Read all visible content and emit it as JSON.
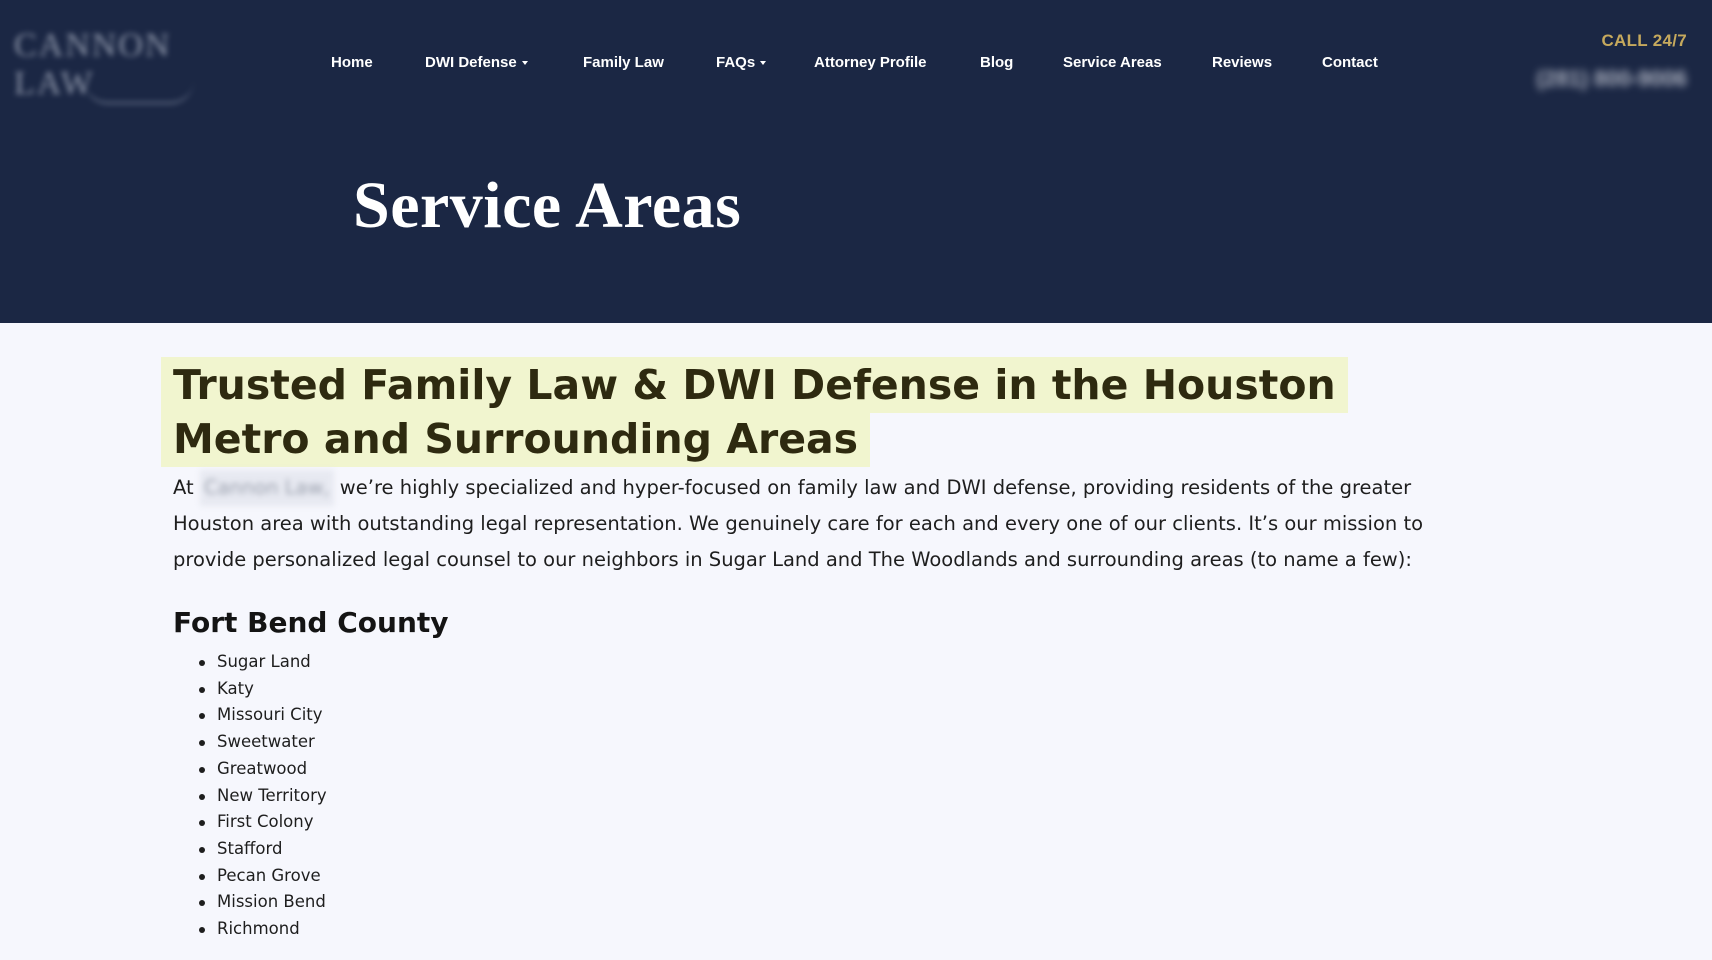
{
  "header": {
    "logo_text": "CANNON LAW",
    "nav": [
      {
        "label": "Home",
        "dropdown": false
      },
      {
        "label": "DWI Defense",
        "dropdown": true
      },
      {
        "label": "Family Law",
        "dropdown": false
      },
      {
        "label": "FAQs",
        "dropdown": true
      },
      {
        "label": "Attorney Profile",
        "dropdown": false
      },
      {
        "label": "Blog",
        "dropdown": false
      },
      {
        "label": "Service Areas",
        "dropdown": false
      },
      {
        "label": "Reviews",
        "dropdown": false
      },
      {
        "label": "Contact",
        "dropdown": false
      }
    ],
    "call_label": "CALL 24/7",
    "phone": "(281) 800-9006"
  },
  "hero": {
    "title": "Service Areas"
  },
  "main": {
    "headline": "Trusted Family Law & DWI Defense in the Houston Metro and Surrounding Areas",
    "intro_prefix": "At",
    "firm_name": "Cannon Law,",
    "intro_text": "we’re highly specialized and hyper-focused on family law and DWI defense, providing residents of the greater Houston area with outstanding legal representation. We genuinely care for each and every one of our clients. It’s our mission to provide personalized legal counsel to our neighbors in Sugar Land and The Woodlands and surrounding areas (to name a few):",
    "county_heading": "Fort Bend County",
    "cities": [
      "Sugar Land",
      "Katy",
      "Missouri City",
      "Sweetwater",
      "Greatwood",
      "New Territory",
      "First Colony",
      "Stafford",
      "Pecan Grove",
      "Mission Bend",
      "Richmond"
    ]
  },
  "colors": {
    "header_bg": "#1b2744",
    "accent_gold": "#c6a95d",
    "highlight": "#f1f5cf",
    "page_bg": "#f6f7fd"
  }
}
